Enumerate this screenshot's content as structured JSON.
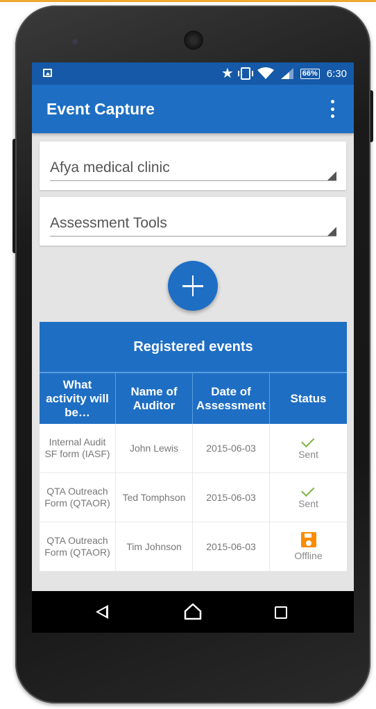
{
  "status_bar": {
    "battery": "66%",
    "time": "6:30"
  },
  "app_bar": {
    "title": "Event Capture"
  },
  "org_unit_spinner": {
    "value": "Afya medical clinic"
  },
  "program_spinner": {
    "value": "Assessment Tools"
  },
  "events": {
    "title": "Registered events",
    "columns": [
      "What activity will be…",
      "Name of Auditor",
      "Date of Assessment",
      "Status"
    ],
    "rows": [
      {
        "activity": "Internal Audit SF form (IASF)",
        "auditor": "John Lewis",
        "date": "2015-06-03",
        "status": "Sent",
        "status_icon": "check-icon"
      },
      {
        "activity": "QTA Outreach Form (QTAOR)",
        "auditor": "Ted Tomphson",
        "date": "2015-06-03",
        "status": "Sent",
        "status_icon": "check-icon"
      },
      {
        "activity": "QTA Outreach Form (QTAOR)",
        "auditor": "Tim Johnson",
        "date": "2015-06-03",
        "status": "Offline",
        "status_icon": "save-icon"
      }
    ]
  },
  "colors": {
    "primary": "#1e6ec4",
    "primary_dark": "#1559a8",
    "sent_green": "#7cb342",
    "offline_orange": "#fb8c00"
  }
}
